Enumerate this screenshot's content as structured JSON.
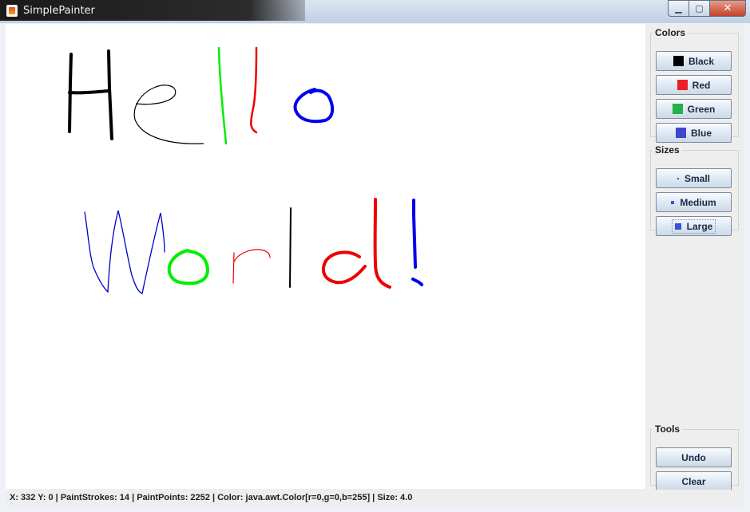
{
  "window": {
    "title": "SimplePainter"
  },
  "colors_panel": {
    "title": "Colors",
    "buttons": [
      {
        "label": "Black",
        "color": "#000000"
      },
      {
        "label": "Red",
        "color": "#ee1c24"
      },
      {
        "label": "Green",
        "color": "#22b14c"
      },
      {
        "label": "Blue",
        "color": "#3f48cc"
      }
    ]
  },
  "sizes_panel": {
    "title": "Sizes",
    "buttons": [
      {
        "label": "Small"
      },
      {
        "label": "Medium"
      },
      {
        "label": "Large",
        "selected": true
      }
    ]
  },
  "tools_panel": {
    "title": "Tools",
    "buttons": [
      {
        "label": "Undo"
      },
      {
        "label": "Clear"
      }
    ]
  },
  "status": {
    "text": "X: 332 Y: 0 | PaintStrokes: 14 | PaintPoints: 2252 | Color: java.awt.Color[r=0,g=0,b=255] | Size: 4.0"
  },
  "canvas": {
    "drawing": [
      {
        "color": "#000000",
        "text": "H"
      },
      {
        "color": "#000000",
        "text": "e"
      },
      {
        "color": "#00ee00",
        "text": "l"
      },
      {
        "color": "#ee0000",
        "text": "l"
      },
      {
        "color": "#0000ee",
        "text": "o"
      },
      {
        "color": "#0000cc",
        "text": "W"
      },
      {
        "color": "#00ee00",
        "text": "o"
      },
      {
        "color": "#ee0000",
        "text": "r"
      },
      {
        "color": "#000000",
        "text": "l"
      },
      {
        "color": "#ee0000",
        "text": "d"
      },
      {
        "color": "#0000ee",
        "text": "!"
      }
    ]
  }
}
